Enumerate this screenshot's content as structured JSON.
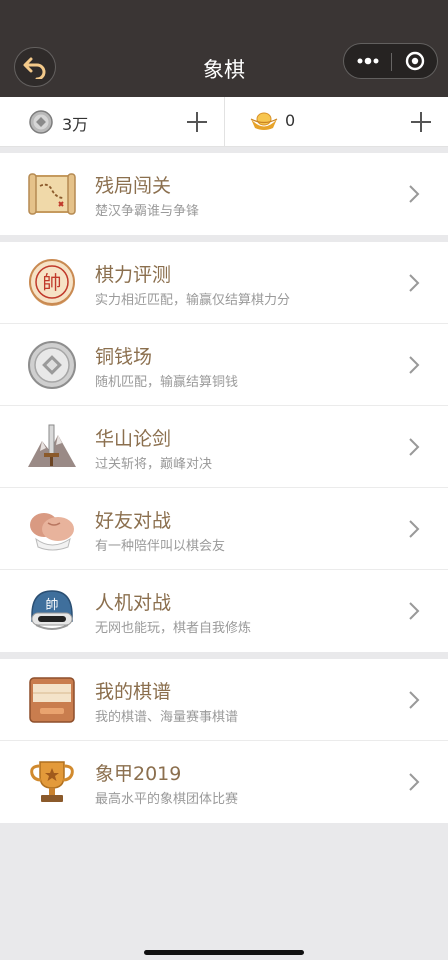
{
  "header": {
    "title": "象棋"
  },
  "currency": {
    "coins": {
      "amount": "3万"
    },
    "ingots": {
      "amount": "0"
    }
  },
  "groups": [
    {
      "items": [
        {
          "title": "残局闯关",
          "subtitle": "楚汉争霸谁与争锋",
          "icon": "scroll-map-icon"
        }
      ]
    },
    {
      "items": [
        {
          "title": "棋力评测",
          "subtitle": "实力相近匹配，输赢仅结算棋力分",
          "icon": "shuai-piece-icon"
        },
        {
          "title": "铜钱场",
          "subtitle": "随机匹配，输赢结算铜钱",
          "icon": "copper-coin-icon"
        },
        {
          "title": "华山论剑",
          "subtitle": "过关斩将，巅峰对决",
          "icon": "sword-mountain-icon"
        },
        {
          "title": "好友对战",
          "subtitle": "有一种陪伴叫以棋会友",
          "icon": "handshake-icon"
        },
        {
          "title": "人机对战",
          "subtitle": "无网也能玩，棋者自我修炼",
          "icon": "robot-helmet-icon"
        }
      ]
    },
    {
      "items": [
        {
          "title": "我的棋谱",
          "subtitle": "我的棋谱、海量赛事棋谱",
          "icon": "record-book-icon"
        },
        {
          "title": "象甲2019",
          "subtitle": "最高水平的象棋团体比赛",
          "icon": "trophy-icon"
        }
      ]
    }
  ],
  "icon_glyphs": {
    "shuai": "帥"
  },
  "colors": {
    "topbar": "#3a3534",
    "title_text": "#8b6f4e",
    "subtitle_text": "#9a9a9a",
    "background": "#e9e9eb"
  }
}
